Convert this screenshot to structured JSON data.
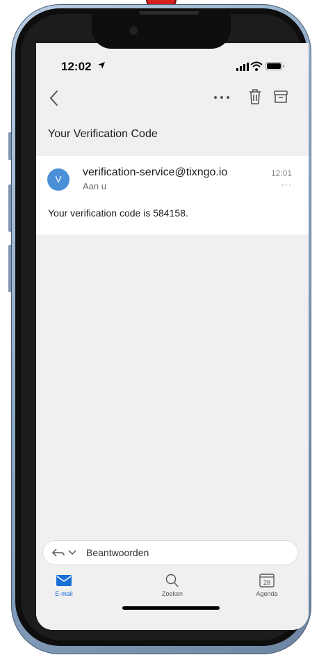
{
  "status_bar": {
    "time": "12:02"
  },
  "message": {
    "subject": "Your Verification Code",
    "avatar_initial": "V",
    "sender": "verification-service@tixngo.io",
    "recipient": "Aan u",
    "time": "12:01",
    "more": "···",
    "body": "Your verification code is 584158."
  },
  "reply": {
    "placeholder": "Beantwoorden"
  },
  "tabs": [
    {
      "label": "E-mail",
      "icon": "mail-icon",
      "active": true
    },
    {
      "label": "Zoeken",
      "icon": "search-icon",
      "active": false
    },
    {
      "label": "Agenda",
      "icon": "calendar-icon",
      "active": false,
      "calendar_day": "28"
    }
  ],
  "colors": {
    "accent": "#1a6fd6",
    "avatar": "#4a90d9",
    "background": "#f0f0f0"
  }
}
